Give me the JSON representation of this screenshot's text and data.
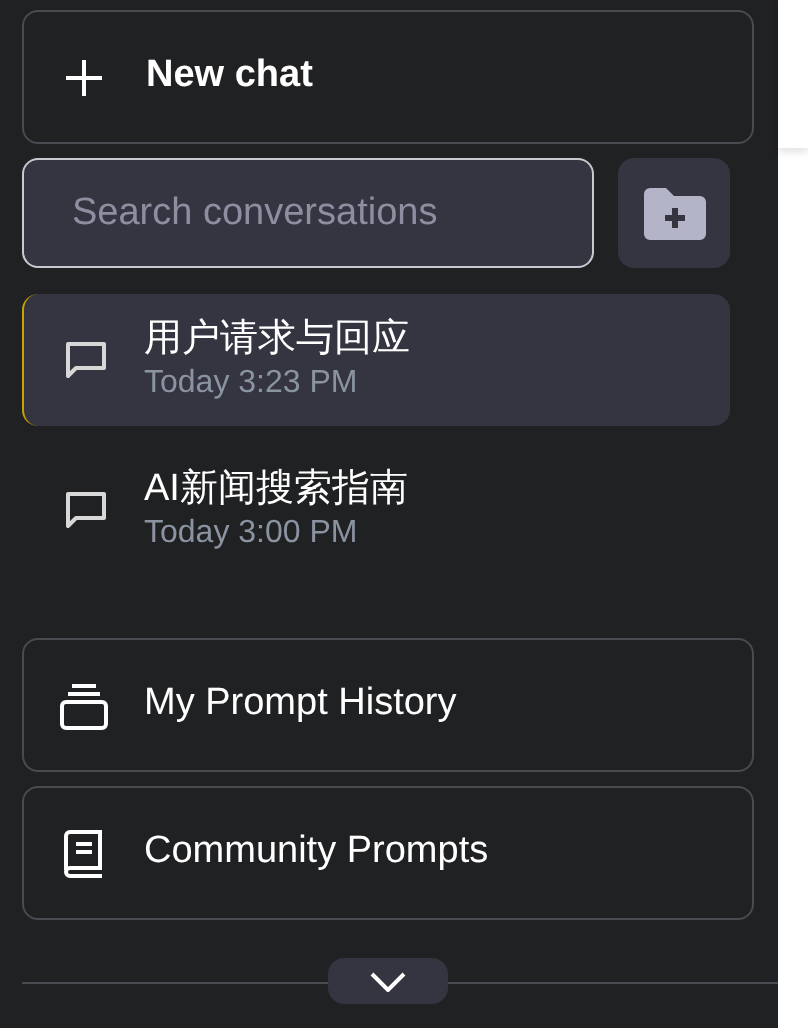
{
  "new_chat": {
    "label": "New chat"
  },
  "search": {
    "placeholder": "Search conversations"
  },
  "conversations": [
    {
      "title": "用户请求与回应",
      "time": "Today 3:23 PM",
      "selected": true
    },
    {
      "title": "AI新闻搜索指南",
      "time": "Today 3:00 PM",
      "selected": false
    }
  ],
  "links": [
    {
      "kind": "history",
      "label": "My Prompt History"
    },
    {
      "kind": "community",
      "label": "Community Prompts"
    }
  ]
}
